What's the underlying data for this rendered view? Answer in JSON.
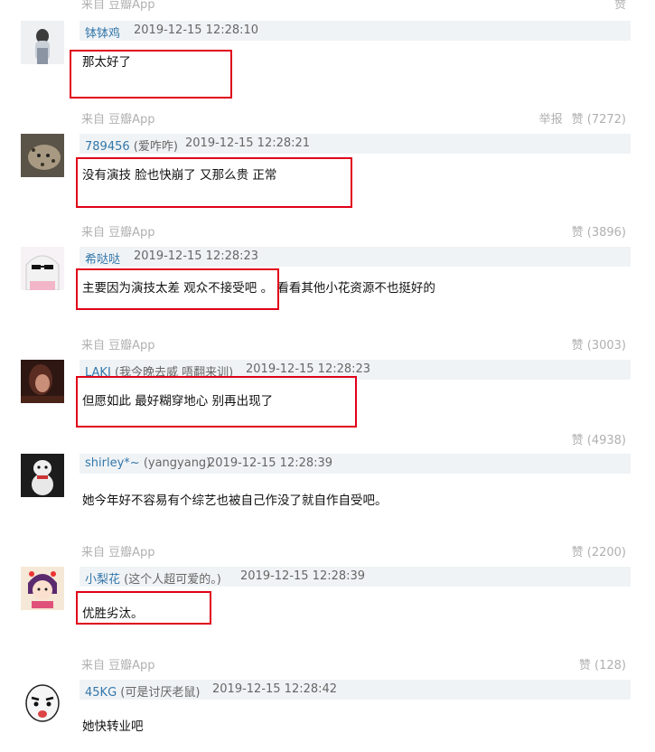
{
  "top_fragment": {
    "source": "来自 豆瓣App",
    "like": "赞"
  },
  "comments": [
    {
      "user": "钵钵鸡",
      "signature": "",
      "time": "2019-12-15 12:28:10",
      "text": "那太好了",
      "footer": {
        "source": "来自 豆瓣App",
        "report": "举报",
        "like": "赞 (7272)"
      }
    },
    {
      "user": "789456",
      "signature": "(爱咋咋)",
      "time": "2019-12-15 12:28:21",
      "text": "没有演技 脸也快崩了 又那么贵 正常",
      "footer": {
        "source": "来自 豆瓣App",
        "like": "赞 (3896)"
      }
    },
    {
      "user": "希哒哒",
      "signature": "",
      "time": "2019-12-15 12:28:23",
      "text": "主要因为演技太差 观众不接受吧 。 看看其他小花资源不也挺好的",
      "footer": {
        "source": "来自 豆瓣App",
        "like": "赞 (3003)"
      }
    },
    {
      "user": "LAKI",
      "signature": "(我今晚去威 唔翻来训)",
      "time": "2019-12-15 12:28:23",
      "text": "但愿如此 最好糊穿地心 别再出现了",
      "footer": {
        "like": "赞 (4938)"
      }
    },
    {
      "user": "shirley*~",
      "signature": "(yangyang)",
      "time": "2019-12-15 12:28:39",
      "text": "她今年好不容易有个综艺也被自己作没了就自作自受吧。",
      "footer": {
        "source": "来自 豆瓣App",
        "like": "赞 (2200)"
      }
    },
    {
      "user": "小梨花",
      "signature": "(这个人超可爱的。)",
      "time": "2019-12-15 12:28:39",
      "text": "优胜劣汰。",
      "footer": {
        "source": "来自 豆瓣App",
        "like": "赞 (128)"
      }
    },
    {
      "user": "45KG",
      "signature": "(可是讨厌老鼠)",
      "time": "2019-12-15 12:28:42",
      "text": "她快转业吧"
    }
  ],
  "colors": {
    "username": "#3377aa",
    "highlight": "#e00018",
    "meta_bg": "#f0f3f5",
    "muted": "#b0b0b0"
  }
}
